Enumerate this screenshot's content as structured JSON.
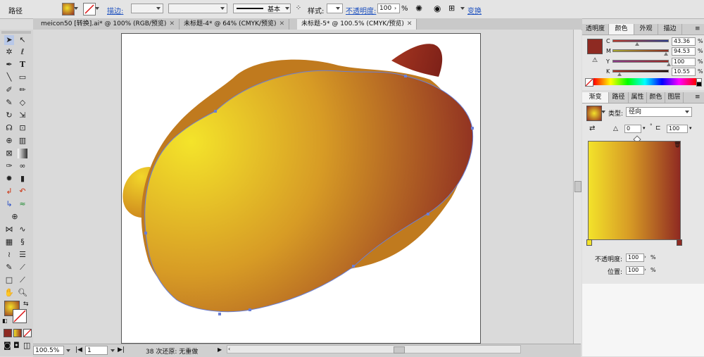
{
  "controlbar": {
    "object_type": "路径",
    "stroke_link": "描边:",
    "brush_label": "基本",
    "style_label": "样式:",
    "opacity_link": "不透明度:",
    "opacity_value": "100",
    "opacity_unit": "%",
    "transform_link": "变换"
  },
  "tabs": [
    {
      "label": "meicon50 [转换].ai* @ 100% (RGB/预览)"
    },
    {
      "label": "未标题-4* @ 64% (CMYK/预览)"
    },
    {
      "label": "未标题-5* @ 100.5% (CMYK/预览)"
    }
  ],
  "color_panel": {
    "tabs": [
      "透明度",
      "颜色",
      "外观",
      "描边"
    ],
    "c_label": "C",
    "c_value": "43.36",
    "m_label": "M",
    "m_value": "94.53",
    "y_label": "Y",
    "y_value": "100",
    "k_label": "K",
    "k_value": "10.55",
    "unit": "%",
    "fill_color": "#8e2a22"
  },
  "gradient_panel": {
    "tabs": [
      "渐变",
      "路径",
      "属性",
      "颜色",
      "图层"
    ],
    "type_label": "类型:",
    "type_value": "径向",
    "angle_value": "0",
    "aspect_value": "100",
    "opacity_label": "不透明度:",
    "opacity_value": "100",
    "location_label": "位置:",
    "location_value": "100",
    "unit": "%",
    "start_color": "#f3e22a",
    "end_color": "#8f2a22"
  },
  "status": {
    "zoom": "100.5%",
    "page": "1",
    "info": "38 次还原: 无重做"
  },
  "colors": {
    "shape_light": "#f4e02c",
    "shape_dark": "#8c2a22",
    "path": "#6a7fd6"
  }
}
